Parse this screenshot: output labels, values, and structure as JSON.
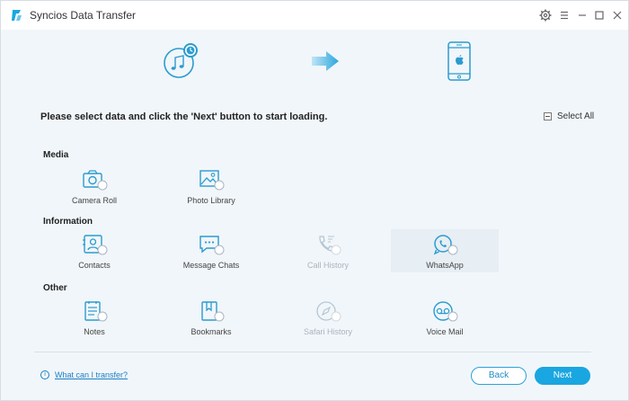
{
  "window": {
    "title": "Syncios Data Transfer",
    "icons": [
      "settings-icon",
      "menu-icon",
      "minimize-icon",
      "maximize-icon",
      "close-icon"
    ]
  },
  "header": {
    "source_icon": "music-circle-icon",
    "arrow_icon": "arrow-right-icon",
    "target_icon": "iphone-icon"
  },
  "instruction": "Please select data and click the 'Next' button to start loading.",
  "select_all": "Select All",
  "sections": {
    "media": {
      "label": "Media",
      "items": [
        {
          "label": "Camera Roll",
          "icon": "camera-icon"
        },
        {
          "label": "Photo Library",
          "icon": "photo-icon"
        }
      ]
    },
    "information": {
      "label": "Information",
      "items": [
        {
          "label": "Contacts",
          "icon": "contacts-icon"
        },
        {
          "label": "Message Chats",
          "icon": "message-icon"
        },
        {
          "label": "Call History",
          "icon": "phone-icon",
          "disabled": true
        },
        {
          "label": "WhatsApp",
          "icon": "whatsapp-icon",
          "selected": true
        }
      ]
    },
    "other": {
      "label": "Other",
      "items": [
        {
          "label": "Notes",
          "icon": "notes-icon"
        },
        {
          "label": "Bookmarks",
          "icon": "bookmark-icon"
        },
        {
          "label": "Safari History",
          "icon": "compass-icon",
          "disabled": true
        },
        {
          "label": "Voice Mail",
          "icon": "voicemail-icon"
        }
      ]
    }
  },
  "footer": {
    "help": "What can I transfer?",
    "back": "Back",
    "next": "Next"
  },
  "colors": {
    "accent": "#1aa6e0",
    "icon": "#2a9ccf",
    "disabled": "#b6c6d2"
  }
}
